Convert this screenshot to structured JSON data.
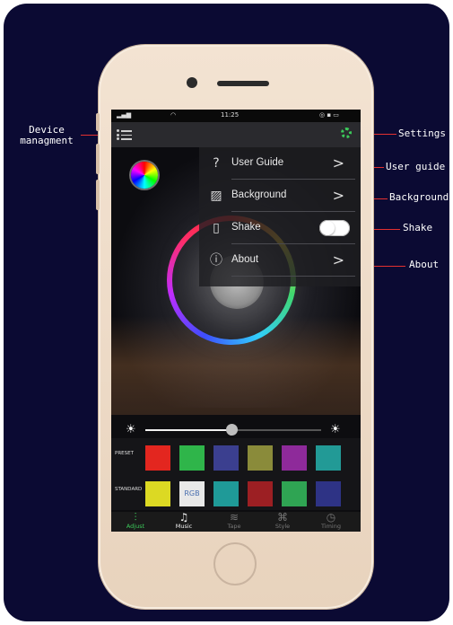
{
  "callouts": {
    "device": "Device\nmanagment",
    "settings": "Settings",
    "user_guide": "User guide",
    "background": "Background",
    "shake": "Shake",
    "about": "About"
  },
  "status_bar": {
    "time": "11:25"
  },
  "menu": [
    {
      "icon": "question-icon",
      "label": "User Guide"
    },
    {
      "icon": "image-icon",
      "label": "Background"
    },
    {
      "icon": "phone-shake-icon",
      "label": "Shake"
    },
    {
      "icon": "info-icon",
      "label": "About"
    }
  ],
  "rows": {
    "preset_label": "PRESET",
    "standard_label": "STANDARD",
    "rgb_label": "RGB",
    "preset_colors": [
      "#e3261f",
      "#2fb54a",
      "#3b3f8f",
      "#8a8b3a",
      "#8e2a9a",
      "#229a96"
    ],
    "standard_colors": [
      "#dcd923",
      "#e8e8e8",
      "#1f9a98",
      "#9c1f23",
      "#2fa453",
      "#2e3385"
    ]
  },
  "tabs": [
    {
      "icon": "adjust-icon",
      "label": "Adjust"
    },
    {
      "icon": "music-icon",
      "label": "Music"
    },
    {
      "icon": "tape-icon",
      "label": "Tape"
    },
    {
      "icon": "style-icon",
      "label": "Style"
    },
    {
      "icon": "timing-icon",
      "label": "Timing"
    }
  ],
  "colors": {
    "accent_green": "#3cc95a",
    "callout_red": "#e33030",
    "background": "#0b0a33"
  }
}
